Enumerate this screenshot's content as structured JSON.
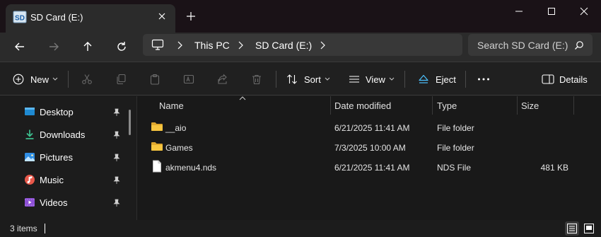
{
  "window": {
    "tab_title": "SD Card (E:)",
    "drive_badge": "SD",
    "new_tab_symbol": "+"
  },
  "navigation": {
    "breadcrumbs": [
      {
        "label": "This PC"
      },
      {
        "label": "SD Card (E:)"
      }
    ],
    "search_placeholder": "Search SD Card (E:)"
  },
  "toolbar": {
    "new_label": "New",
    "sort_label": "Sort",
    "view_label": "View",
    "eject_label": "Eject",
    "more_label": "...",
    "details_label": "Details"
  },
  "nav_pane": {
    "items": [
      {
        "label": "Desktop",
        "icon": "desktop-icon",
        "pinned": true
      },
      {
        "label": "Downloads",
        "icon": "downloads-icon",
        "pinned": true
      },
      {
        "label": "Pictures",
        "icon": "pictures-icon",
        "pinned": true
      },
      {
        "label": "Music",
        "icon": "music-icon",
        "pinned": true
      },
      {
        "label": "Videos",
        "icon": "videos-icon",
        "pinned": true
      }
    ]
  },
  "file_list": {
    "columns": {
      "name": "Name",
      "date_modified": "Date modified",
      "type": "Type",
      "size": "Size"
    },
    "sort_column": "Name",
    "rows": [
      {
        "name": "__aio",
        "date_modified": "6/21/2025 11:41 AM",
        "type": "File folder",
        "size": "",
        "icon": "folder-icon"
      },
      {
        "name": "Games",
        "date_modified": "7/3/2025 10:00 AM",
        "type": "File folder",
        "size": "",
        "icon": "folder-icon"
      },
      {
        "name": "akmenu4.nds",
        "date_modified": "6/21/2025 11:41 AM",
        "type": "NDS File",
        "size": "481 KB",
        "icon": "file-icon"
      }
    ]
  },
  "status_bar": {
    "item_count": "3 items"
  },
  "colors": {
    "folder_yellow": "#f8c640",
    "accent_blue": "#4cc2ff",
    "background": "#1c1c1c"
  }
}
